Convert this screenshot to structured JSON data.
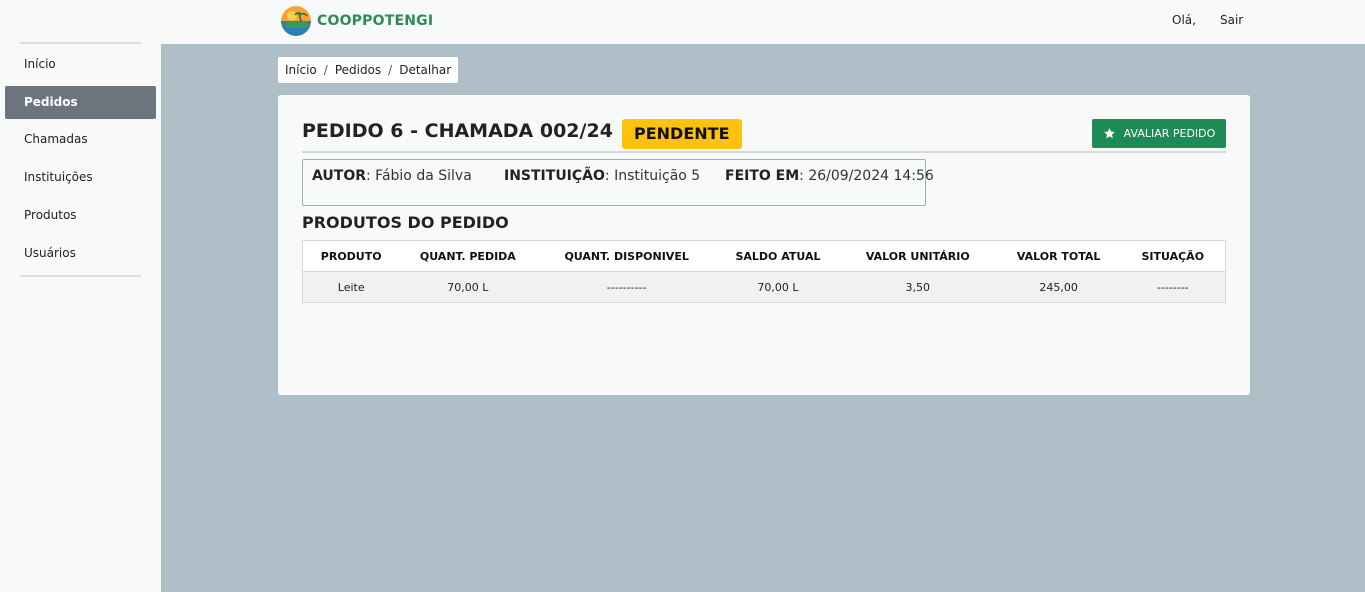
{
  "header": {
    "brand_name": "COOPPOTENGI",
    "greeting": "Olá,",
    "logout_label": "Sair"
  },
  "sidebar": {
    "items": [
      {
        "label": "Início",
        "active": false
      },
      {
        "label": "Pedidos",
        "active": true
      },
      {
        "label": "Chamadas",
        "active": false
      },
      {
        "label": "Instituições",
        "active": false
      },
      {
        "label": "Produtos",
        "active": false
      },
      {
        "label": "Usuários",
        "active": false
      }
    ]
  },
  "breadcrumb": {
    "items": [
      "Início",
      "Pedidos",
      "Detalhar"
    ],
    "separator": "/"
  },
  "order": {
    "title": "PEDIDO 6 - CHAMADA 002/24",
    "status": "PENDENTE",
    "status_color": "#fdc10e",
    "evaluate_label": "AVALIAR PEDIDO",
    "evaluate_icon": "star-icon",
    "accent_color": "#1e8a55",
    "author_label": "AUTOR",
    "author_value": ": Fábio da Silva",
    "institution_label": "INSTITUIÇÃO",
    "institution_value": ": Instituição 5",
    "made_at_label": "FEITO EM",
    "made_at_value": ": 26/09/2024 14:56"
  },
  "products": {
    "section_title": "PRODUTOS DO PEDIDO",
    "columns": [
      "PRODUTO",
      "QUANT. PEDIDA",
      "QUANT. DISPONIVEL",
      "SALDO ATUAL",
      "VALOR UNITÁRIO",
      "VALOR TOTAL",
      "SITUAÇÃO"
    ],
    "rows": [
      [
        "Leite",
        "70,00 L",
        "----------",
        "70,00 L",
        "3,50",
        "245,00",
        "--------"
      ]
    ]
  }
}
